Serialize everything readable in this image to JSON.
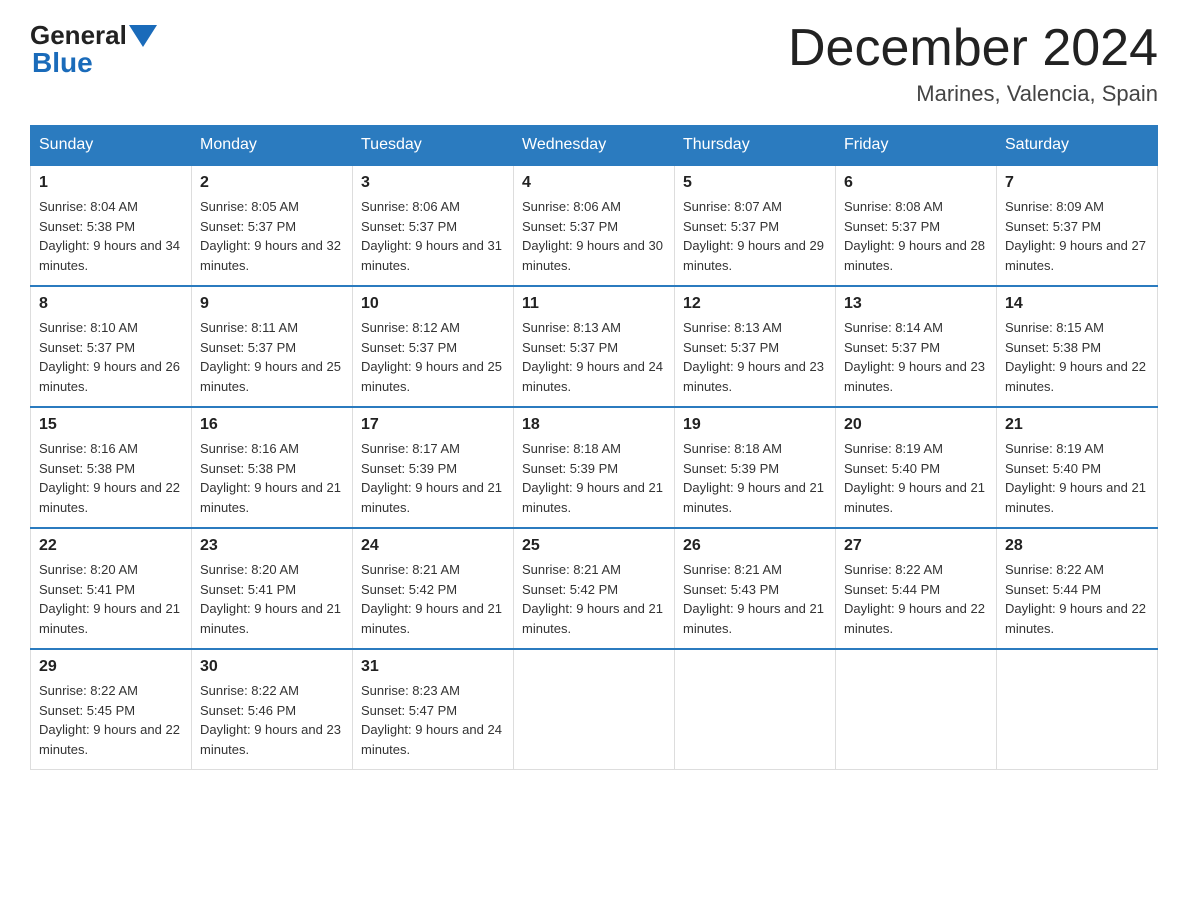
{
  "header": {
    "logo": {
      "general": "General",
      "blue": "Blue"
    },
    "title": "December 2024",
    "location": "Marines, Valencia, Spain"
  },
  "days_of_week": [
    "Sunday",
    "Monday",
    "Tuesday",
    "Wednesday",
    "Thursday",
    "Friday",
    "Saturday"
  ],
  "weeks": [
    [
      {
        "day": "1",
        "sunrise": "8:04 AM",
        "sunset": "5:38 PM",
        "daylight": "9 hours and 34 minutes."
      },
      {
        "day": "2",
        "sunrise": "8:05 AM",
        "sunset": "5:37 PM",
        "daylight": "9 hours and 32 minutes."
      },
      {
        "day": "3",
        "sunrise": "8:06 AM",
        "sunset": "5:37 PM",
        "daylight": "9 hours and 31 minutes."
      },
      {
        "day": "4",
        "sunrise": "8:06 AM",
        "sunset": "5:37 PM",
        "daylight": "9 hours and 30 minutes."
      },
      {
        "day": "5",
        "sunrise": "8:07 AM",
        "sunset": "5:37 PM",
        "daylight": "9 hours and 29 minutes."
      },
      {
        "day": "6",
        "sunrise": "8:08 AM",
        "sunset": "5:37 PM",
        "daylight": "9 hours and 28 minutes."
      },
      {
        "day": "7",
        "sunrise": "8:09 AM",
        "sunset": "5:37 PM",
        "daylight": "9 hours and 27 minutes."
      }
    ],
    [
      {
        "day": "8",
        "sunrise": "8:10 AM",
        "sunset": "5:37 PM",
        "daylight": "9 hours and 26 minutes."
      },
      {
        "day": "9",
        "sunrise": "8:11 AM",
        "sunset": "5:37 PM",
        "daylight": "9 hours and 25 minutes."
      },
      {
        "day": "10",
        "sunrise": "8:12 AM",
        "sunset": "5:37 PM",
        "daylight": "9 hours and 25 minutes."
      },
      {
        "day": "11",
        "sunrise": "8:13 AM",
        "sunset": "5:37 PM",
        "daylight": "9 hours and 24 minutes."
      },
      {
        "day": "12",
        "sunrise": "8:13 AM",
        "sunset": "5:37 PM",
        "daylight": "9 hours and 23 minutes."
      },
      {
        "day": "13",
        "sunrise": "8:14 AM",
        "sunset": "5:37 PM",
        "daylight": "9 hours and 23 minutes."
      },
      {
        "day": "14",
        "sunrise": "8:15 AM",
        "sunset": "5:38 PM",
        "daylight": "9 hours and 22 minutes."
      }
    ],
    [
      {
        "day": "15",
        "sunrise": "8:16 AM",
        "sunset": "5:38 PM",
        "daylight": "9 hours and 22 minutes."
      },
      {
        "day": "16",
        "sunrise": "8:16 AM",
        "sunset": "5:38 PM",
        "daylight": "9 hours and 21 minutes."
      },
      {
        "day": "17",
        "sunrise": "8:17 AM",
        "sunset": "5:39 PM",
        "daylight": "9 hours and 21 minutes."
      },
      {
        "day": "18",
        "sunrise": "8:18 AM",
        "sunset": "5:39 PM",
        "daylight": "9 hours and 21 minutes."
      },
      {
        "day": "19",
        "sunrise": "8:18 AM",
        "sunset": "5:39 PM",
        "daylight": "9 hours and 21 minutes."
      },
      {
        "day": "20",
        "sunrise": "8:19 AM",
        "sunset": "5:40 PM",
        "daylight": "9 hours and 21 minutes."
      },
      {
        "day": "21",
        "sunrise": "8:19 AM",
        "sunset": "5:40 PM",
        "daylight": "9 hours and 21 minutes."
      }
    ],
    [
      {
        "day": "22",
        "sunrise": "8:20 AM",
        "sunset": "5:41 PM",
        "daylight": "9 hours and 21 minutes."
      },
      {
        "day": "23",
        "sunrise": "8:20 AM",
        "sunset": "5:41 PM",
        "daylight": "9 hours and 21 minutes."
      },
      {
        "day": "24",
        "sunrise": "8:21 AM",
        "sunset": "5:42 PM",
        "daylight": "9 hours and 21 minutes."
      },
      {
        "day": "25",
        "sunrise": "8:21 AM",
        "sunset": "5:42 PM",
        "daylight": "9 hours and 21 minutes."
      },
      {
        "day": "26",
        "sunrise": "8:21 AM",
        "sunset": "5:43 PM",
        "daylight": "9 hours and 21 minutes."
      },
      {
        "day": "27",
        "sunrise": "8:22 AM",
        "sunset": "5:44 PM",
        "daylight": "9 hours and 22 minutes."
      },
      {
        "day": "28",
        "sunrise": "8:22 AM",
        "sunset": "5:44 PM",
        "daylight": "9 hours and 22 minutes."
      }
    ],
    [
      {
        "day": "29",
        "sunrise": "8:22 AM",
        "sunset": "5:45 PM",
        "daylight": "9 hours and 22 minutes."
      },
      {
        "day": "30",
        "sunrise": "8:22 AM",
        "sunset": "5:46 PM",
        "daylight": "9 hours and 23 minutes."
      },
      {
        "day": "31",
        "sunrise": "8:23 AM",
        "sunset": "5:47 PM",
        "daylight": "9 hours and 24 minutes."
      },
      null,
      null,
      null,
      null
    ]
  ]
}
